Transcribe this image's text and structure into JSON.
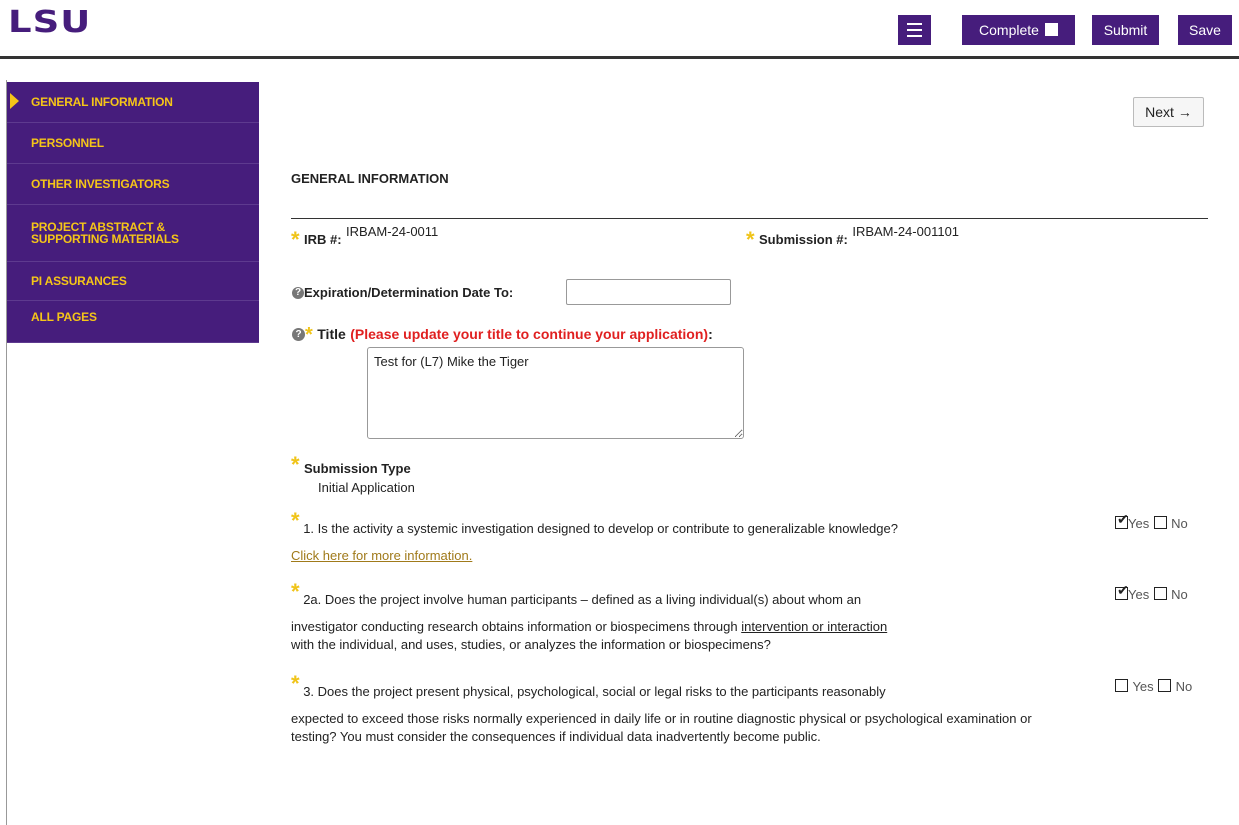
{
  "header": {
    "logo": "LSU",
    "complete_label": "Complete",
    "submit_label": "Submit",
    "save_label": "Save"
  },
  "sidebar": {
    "items": [
      {
        "label": "GENERAL INFORMATION"
      },
      {
        "label": "PERSONNEL"
      },
      {
        "label": "OTHER INVESTIGATORS"
      },
      {
        "label": "PROJECT ABSTRACT & SUPPORTING MATERIALS"
      },
      {
        "label": "PI ASSURANCES"
      },
      {
        "label": "ALL PAGES"
      }
    ]
  },
  "main": {
    "next_label": "Next →",
    "section_title": "GENERAL INFORMATION",
    "irb_label": "IRB #:",
    "irb_value": "IRBAM-24-0011",
    "submission_label": "Submission #:",
    "submission_value": "IRBAM-24-001101",
    "expiration_label": "Expiration/Determination Date To:",
    "expiration_value": "",
    "title_label": "Title",
    "title_note": "(Please update your title to continue your application)",
    "title_value": "Test for (L7) Mike the Tiger",
    "submission_type_label": "Submission Type",
    "submission_type_value": "Initial Application",
    "yes_label": "Yes",
    "no_label": "No",
    "q1": "1. Is the activity a systemic investigation designed to develop or contribute to generalizable knowledge?",
    "q1_link": "Click here for more information.",
    "q2a_line1": "2a. Does the project involve human participants – defined as a living individual(s) about whom an",
    "q2a_line2_pre": "investigator conducting research obtains information or biospecimens through ",
    "q2a_line2_link": "intervention or interaction",
    "q2a_line3": "with the individual, and uses, studies, or analyzes the information or biospecimens?",
    "q3_line1": "3. Does the project present physical, psychological, social or legal risks to the participants reasonably",
    "q3_rest": "expected to exceed those risks normally experienced in daily life or in routine diagnostic physical or psychological examination or testing? You must consider the consequences if individual data inadvertently become public.",
    "answers": {
      "q1": "Yes",
      "q2a": "Yes",
      "q3": ""
    }
  }
}
